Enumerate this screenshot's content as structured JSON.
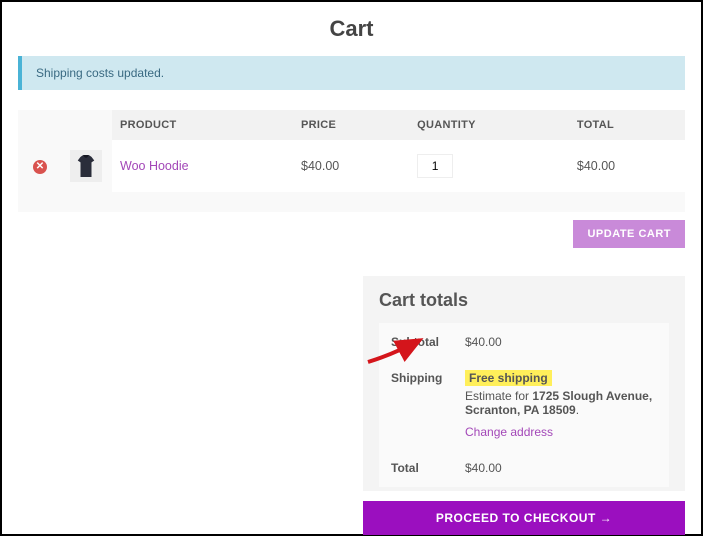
{
  "page": {
    "title": "Cart"
  },
  "notice": {
    "message": "Shipping costs updated."
  },
  "table": {
    "headers": {
      "product": "PRODUCT",
      "price": "PRICE",
      "quantity": "QUANTITY",
      "total": "TOTAL"
    },
    "items": [
      {
        "name": "Woo Hoodie",
        "price": "$40.00",
        "qty": "1",
        "total": "$40.00"
      }
    ],
    "update_label": "UPDATE CART"
  },
  "totals": {
    "title": "Cart totals",
    "subtotal_label": "Subtotal",
    "subtotal": "$40.00",
    "shipping_label": "Shipping",
    "shipping_method": "Free shipping",
    "estimate_prefix": "Estimate for ",
    "address": "1725 Slough Avenue, Scranton, PA 18509",
    "address_suffix": ".",
    "change_address": "Change address",
    "total_label": "Total",
    "total": "$40.00"
  },
  "checkout": {
    "label": "PROCEED TO CHECKOUT  →"
  }
}
